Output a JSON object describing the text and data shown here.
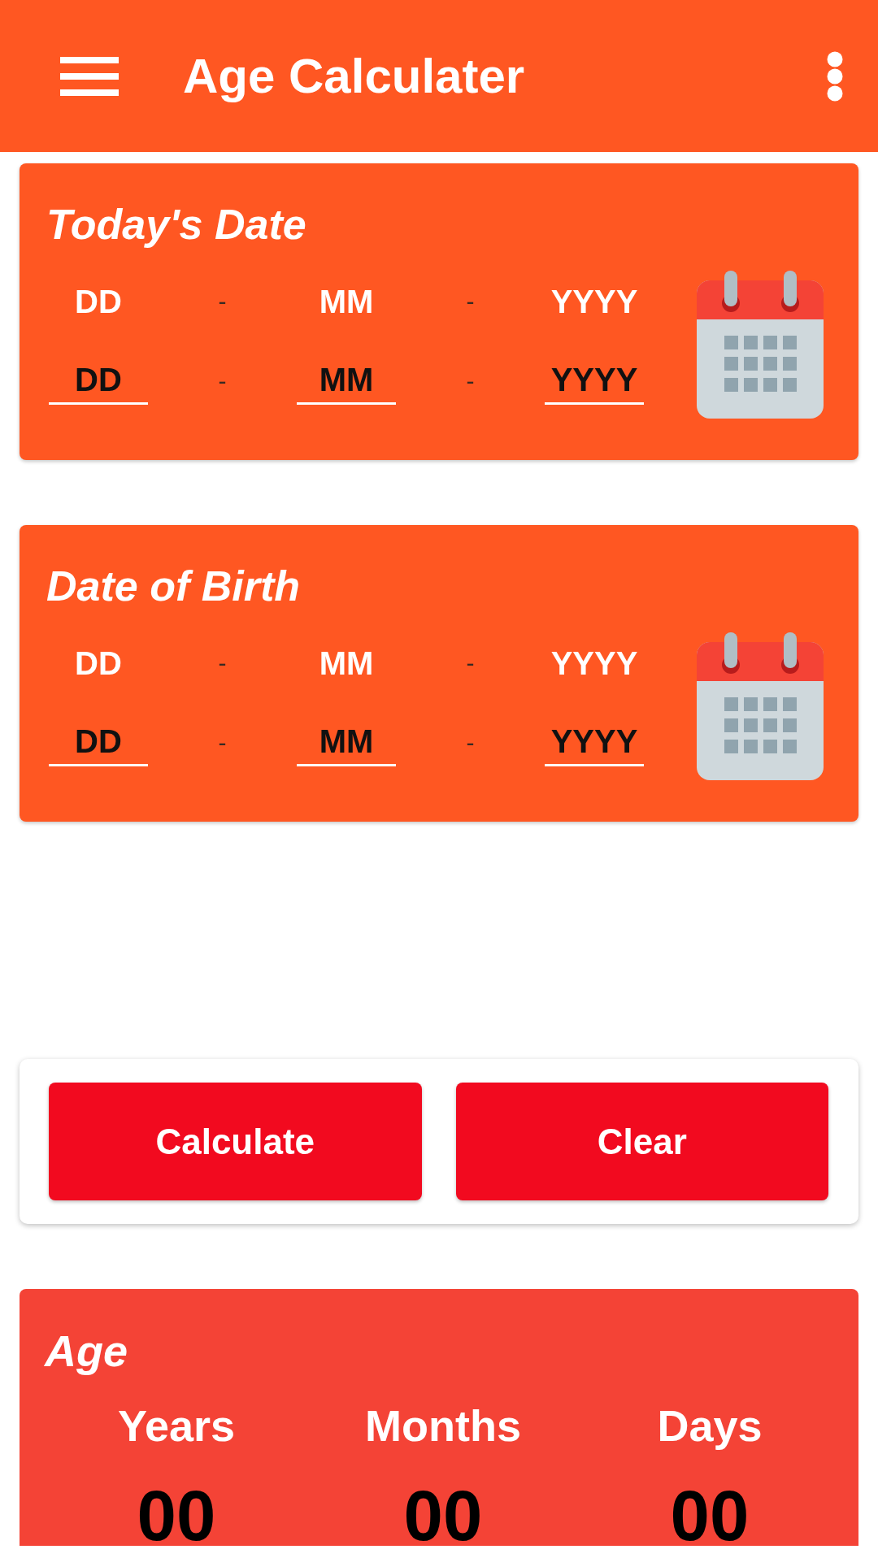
{
  "app_bar": {
    "title": "Age Calculater"
  },
  "date_cards": [
    {
      "title": "Today's Date",
      "fields": [
        {
          "label": "DD",
          "placeholder": "DD"
        },
        {
          "label": "MM",
          "placeholder": "MM"
        },
        {
          "label": "YYYY",
          "placeholder": "YYYY"
        }
      ],
      "label_separators": [
        "-",
        "-"
      ],
      "field_separators": [
        "-",
        "-"
      ]
    },
    {
      "title": "Date of Birth",
      "fields": [
        {
          "label": "DD",
          "placeholder": "DD"
        },
        {
          "label": "MM",
          "placeholder": "MM"
        },
        {
          "label": "YYYY",
          "placeholder": "YYYY"
        }
      ],
      "label_separators": [
        "-",
        "-"
      ],
      "field_separators": [
        "-",
        "-"
      ]
    }
  ],
  "buttons": [
    {
      "label": "Calculate"
    },
    {
      "label": "Clear"
    }
  ],
  "result": {
    "title": "Age",
    "columns": [
      {
        "label": "Years",
        "value": "00"
      },
      {
        "label": "Months",
        "value": "00"
      },
      {
        "label": "Days",
        "value": "00"
      }
    ]
  }
}
